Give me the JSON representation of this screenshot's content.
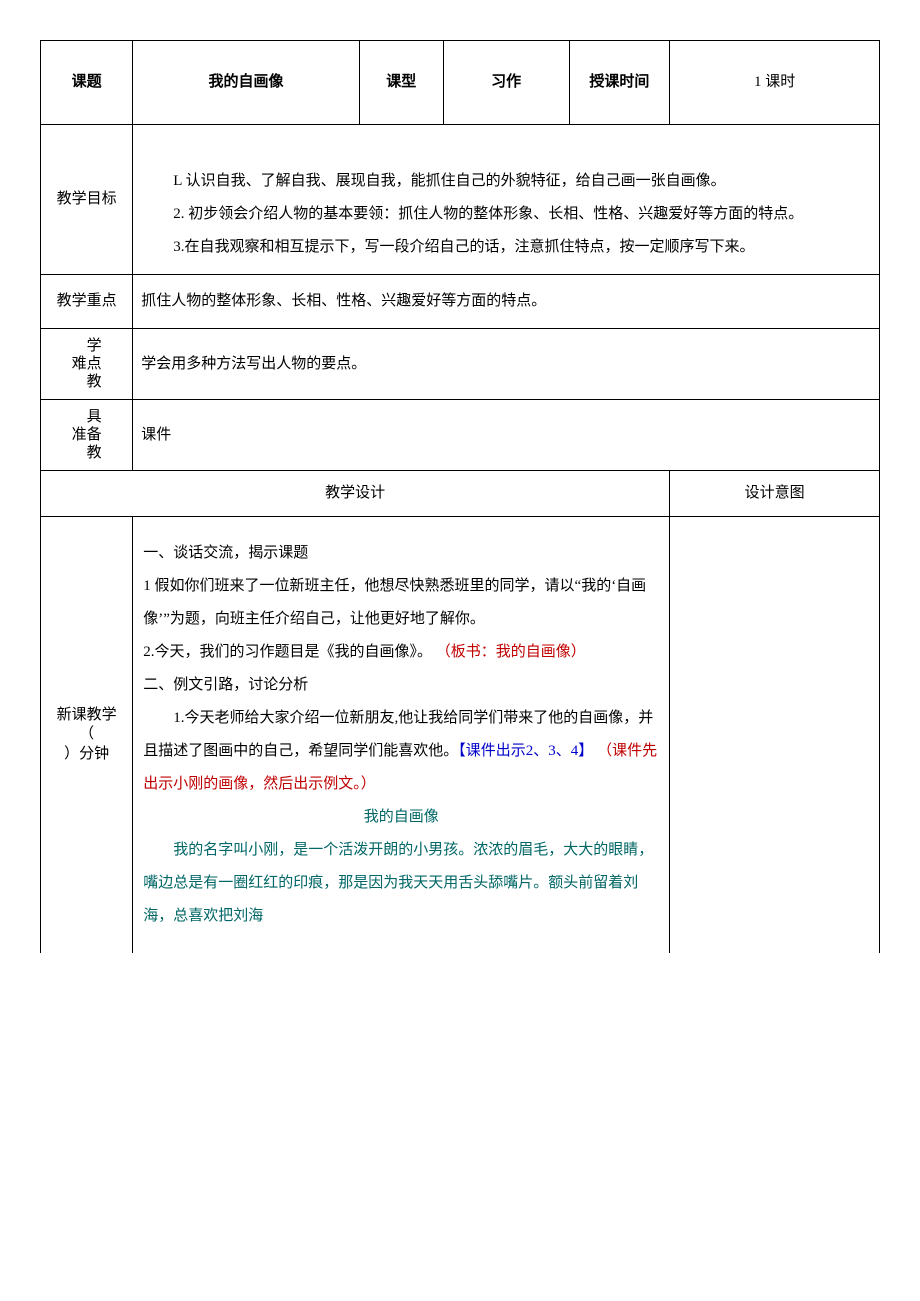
{
  "header": {
    "topic_label": "课题",
    "topic_value": "我的自画像",
    "type_label": "课型",
    "type_value": "习作",
    "time_label": "授课时间",
    "time_value": "1 课时"
  },
  "goal": {
    "label": "教学目标",
    "line1": "L 认识自我、了解自我、展现自我，能抓住自己的外貌特征，给自己画一张自画像。",
    "line2": "2. 初步领会介绍人物的基本要领：抓住人物的整体形象、长相、性格、兴趣爱好等方面的特点。",
    "line3": "3.在自我观察和相互提示下，写一段介绍自己的话，注意抓住特点，按一定顺序写下来。"
  },
  "focus": {
    "label": "教学重点",
    "value": "抓住人物的整体形象、长相、性格、兴趣爱好等方面的特点。"
  },
  "difficulty": {
    "label_c1": "难",
    "label_c2a": "学",
    "label_c2b": "点",
    "label_c2c": "教",
    "value": "学会用多种方法写出人物的要点。"
  },
  "prep": {
    "label_c1": "准",
    "label_c2a": "具",
    "label_c2b": "备",
    "label_c2c": "教",
    "value": "课件"
  },
  "design": {
    "left_label": "教学设计",
    "right_label": "设计意图"
  },
  "section": {
    "side_l1": "新课教学",
    "side_l2": "（",
    "side_l3": "）分钟"
  },
  "content": {
    "h1": "一、谈话交流，揭示课题",
    "p1": "1 假如你们班来了一位新班主任，他想尽快熟悉班里的同学，请以“我的‘自画像’”为题，向班主任介绍自己，让他更好地了解你。",
    "p2a": "2.今天，我们的习作题目是《我的自画像》。",
    "p2b": "（板书：我的自画像）",
    "h2": "二、例文引路，讨论分析",
    "p3a": "1.今天老师给大家介绍一位新朋友,他让我给同学们带来了他的自画像，并且描述了图画中的自己，希望同学们能喜欢他。",
    "p3b": "【课件出示2、3、4】",
    "p3c": "（课件先出示小刚的画像，然后出示例文。）",
    "title_center": "我的自画像",
    "p4": "我的名字叫小刚，是一个活泼开朗的小男孩。浓浓的眉毛，大大的眼睛，嘴边总是有一圈红红的印痕，那是因为我天天用舌头舔嘴片。额头前留着刘海，总喜欢把刘海"
  }
}
